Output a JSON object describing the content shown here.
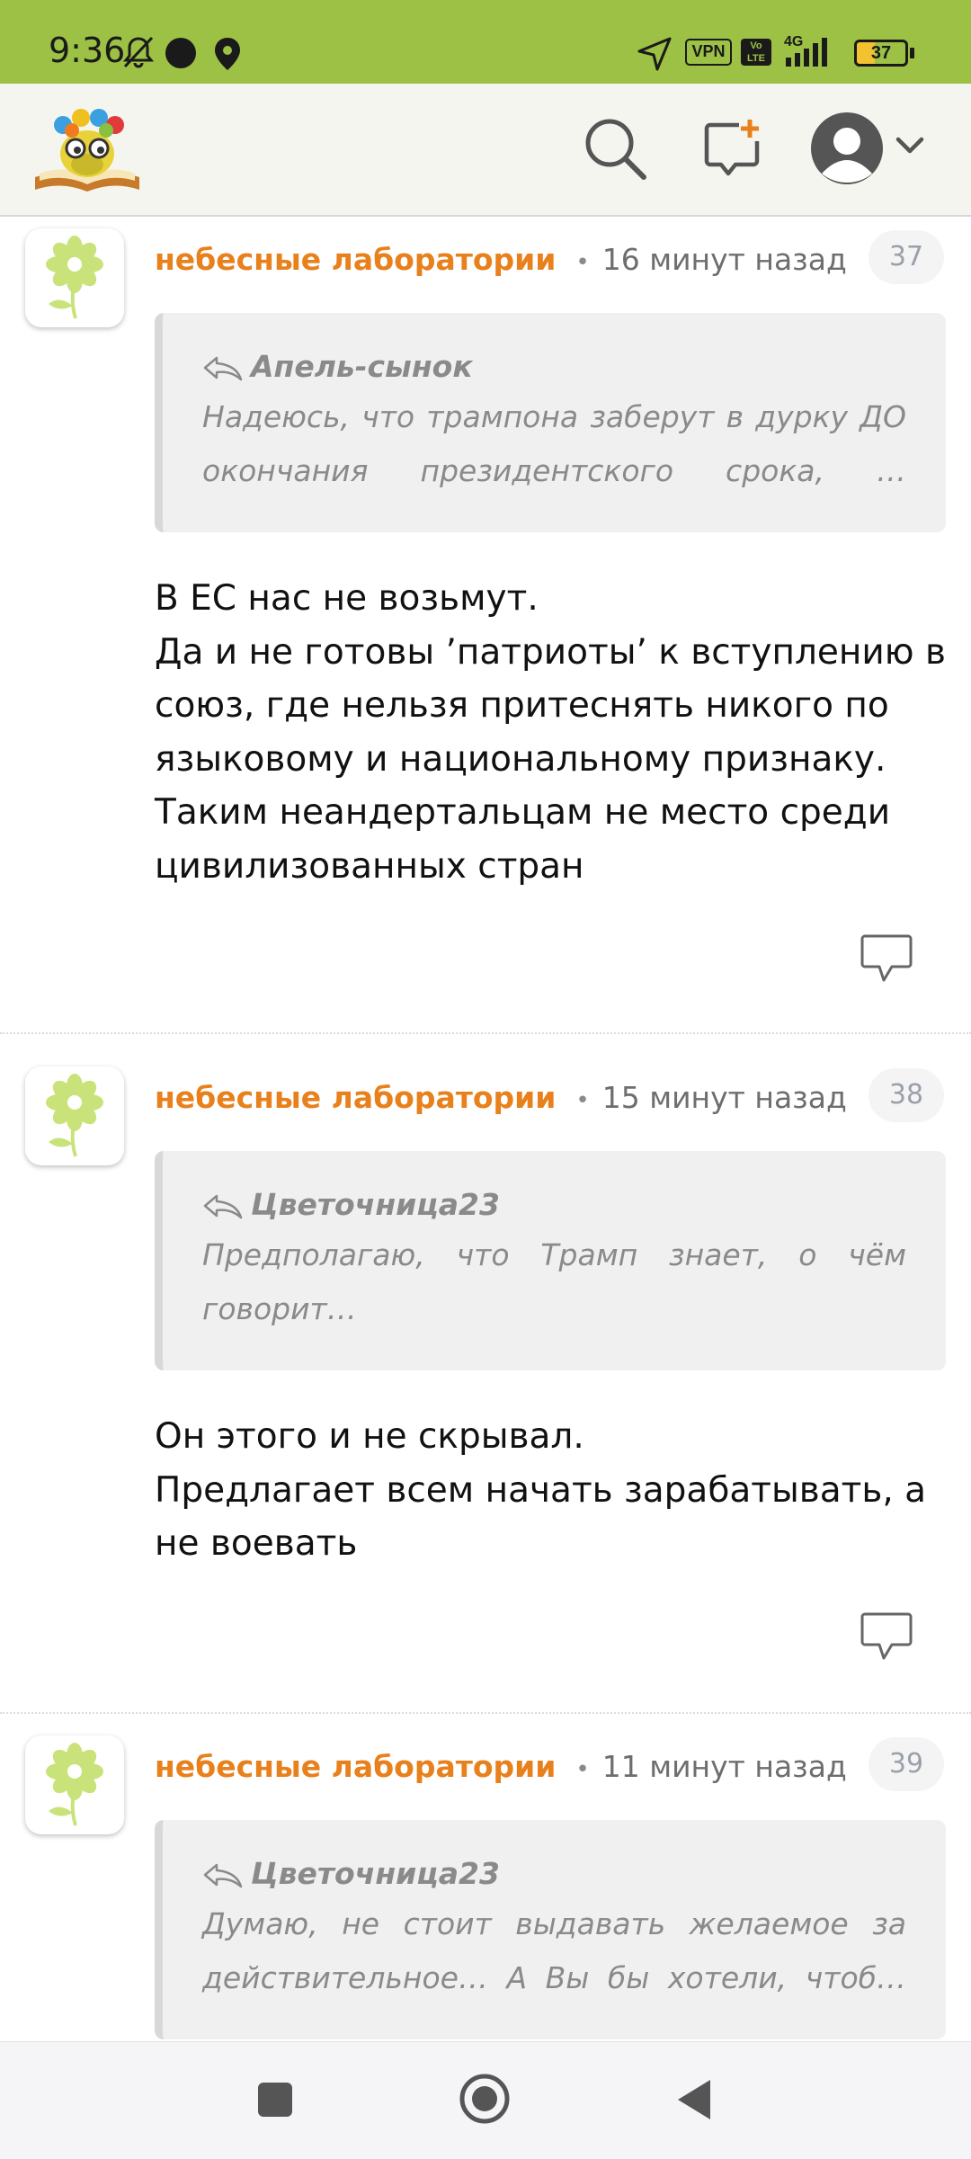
{
  "status_bar": {
    "time": "9:36",
    "battery": "37",
    "network": "4G",
    "vpn_label": "VPN",
    "volte_label": "Vo LTE",
    "background_color": "#9cc145"
  },
  "header": {
    "logo_icon": "reading-bookworm-logo",
    "search_icon": "search-icon",
    "new_post_icon": "add-comment-icon",
    "profile_icon": "avatar-icon",
    "dropdown_icon": "chevron-down-icon"
  },
  "colors": {
    "author": "#e8801c",
    "quote_bg": "#f0f0f0",
    "accent_green": "#9cc145"
  },
  "comments": [
    {
      "author": "небесные лаборатории",
      "time": "16 минут назад",
      "number": "37",
      "quote_author": "Апель-сынок",
      "quote_text": "Надеюсь, что трампона заберут в дурку ДО\nокончания президентского срока, …",
      "body": "В ЕС нас не возьмут.\nДа и не готовы ’патриоты’ к вступлению в\nсоюз, где нельзя притеснять никого по\nязыковому и национальному признаку.\nТаким неандертальцам не место среди\nцивилизованных стран"
    },
    {
      "author": "небесные лаборатории",
      "time": "15 минут назад",
      "number": "38",
      "quote_author": "Цветочница23",
      "quote_text": "Предполагаю, что Трамп знает, о чём\nговорит…",
      "body": "Он этого и не скрывал.\nПредлагает всем начать зарабатывать, а\nне воевать"
    },
    {
      "author": "небесные лаборатории",
      "time": "11 минут назад",
      "number": "39",
      "quote_author": "Цветочница23",
      "quote_text": "Думаю, не стоит выдавать желаемое за\nдействительное… А Вы бы хотели, чтоб…",
      "body": ""
    }
  ],
  "nav_bar": {
    "recents_icon": "square-icon",
    "home_icon": "circle-home-icon",
    "back_icon": "triangle-back-icon"
  }
}
